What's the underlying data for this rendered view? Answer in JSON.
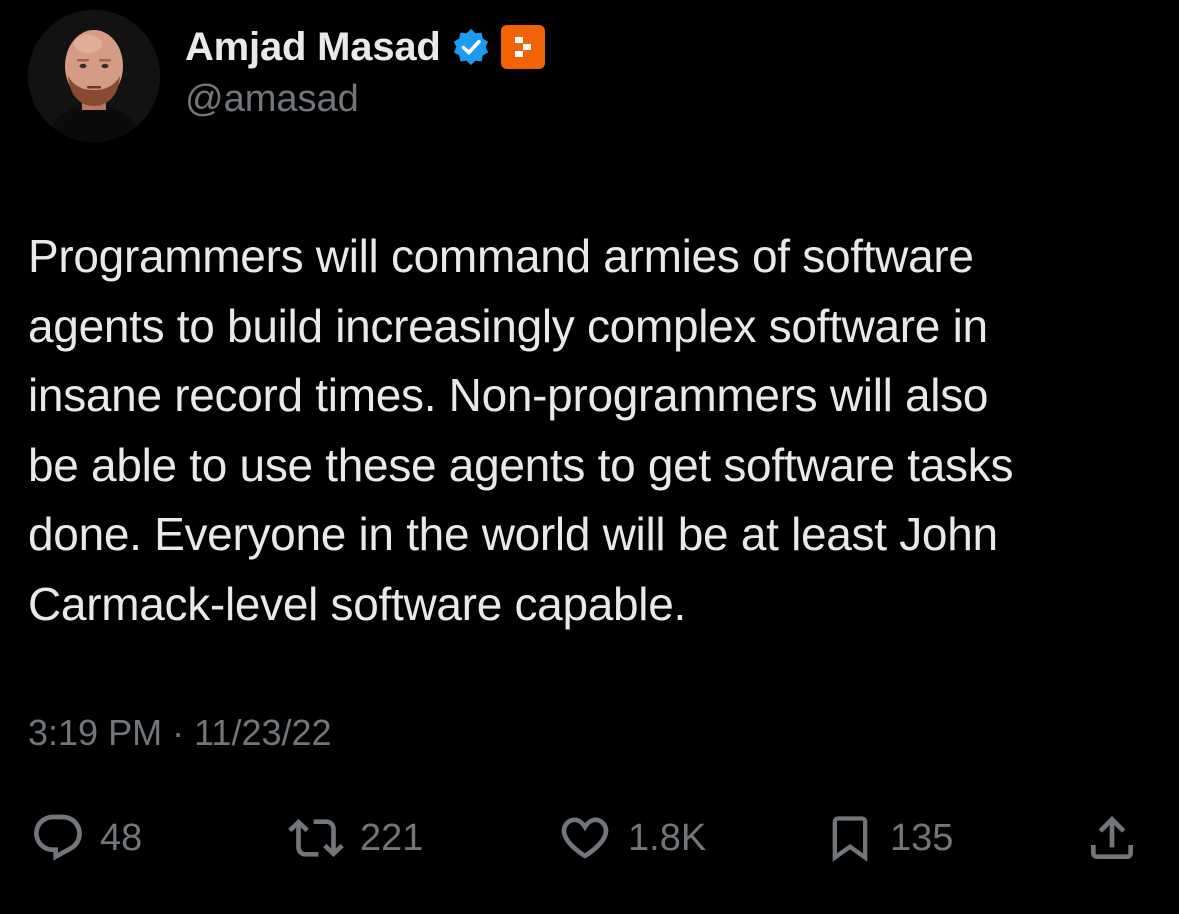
{
  "author": {
    "display_name": "Amjad Masad",
    "handle": "@amasad",
    "verified_badge_color": "#1D9BF0",
    "affiliate_badge_color": "#F26207"
  },
  "tweet": {
    "text_lines": [
      "Programmers will command armies of software",
      "agents to build increasingly complex software in",
      "insane record times. Non-programmers will also",
      "be able to use these agents to get software tasks",
      "done. Everyone in the world will be at least John",
      "Carmack-level software capable."
    ],
    "time": "3:19 PM",
    "separator": "·",
    "date": "11/23/22"
  },
  "actions": {
    "replies": "48",
    "retweets": "221",
    "likes": "1.8K",
    "bookmarks": "135"
  },
  "icons": [
    "reply-icon",
    "retweet-icon",
    "like-icon",
    "bookmark-icon",
    "share-icon",
    "verified-badge-icon",
    "affiliate-badge-icon"
  ],
  "colors": {
    "background": "#000000",
    "primary_text": "#e7e9ea",
    "secondary_text": "#71767b"
  }
}
